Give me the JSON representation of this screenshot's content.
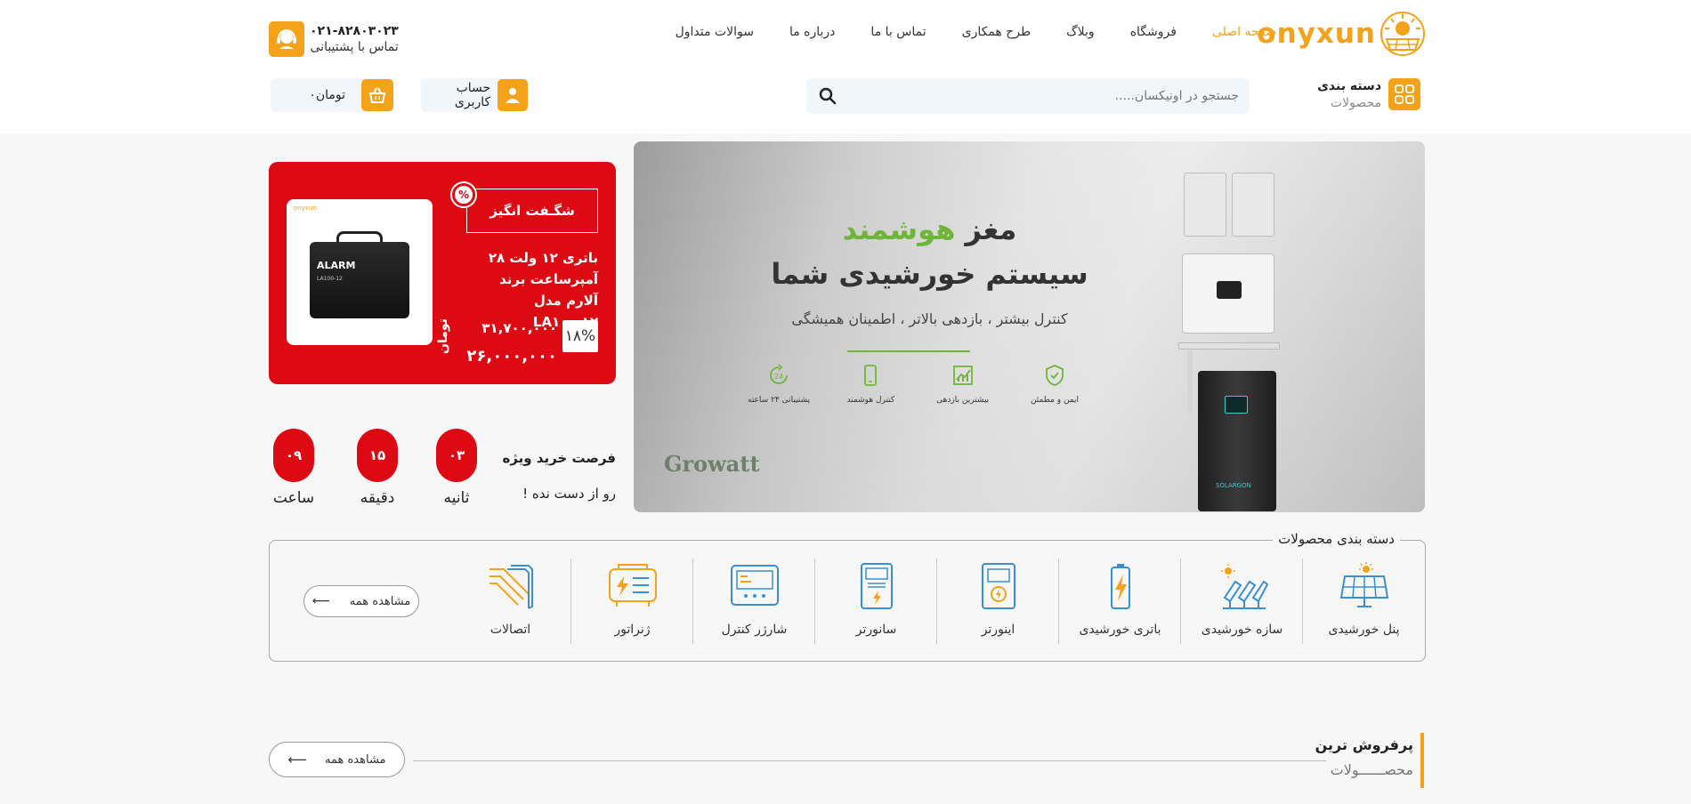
{
  "header": {
    "logo_text": "onyxun",
    "nav": [
      {
        "label": "صفحه اصلی",
        "active": true
      },
      {
        "label": "فروشگاه"
      },
      {
        "label": "وبلاگ"
      },
      {
        "label": "طرح همکاری"
      },
      {
        "label": "تماس با ما"
      },
      {
        "label": "درباره ما"
      },
      {
        "label": "سوالات متداول"
      }
    ],
    "support_phone": "۰۲۱-۸۲۸۰۳۰۲۳",
    "support_label": "تماس با پشتیبانی",
    "category_title": "دسته بندی",
    "category_sub": "محصولات",
    "search_placeholder": "جستجو در اونیکسان.....",
    "account_label": "حساب کاربری",
    "cart_label": "تومان۰"
  },
  "banner": {
    "headline_1": "مغز ",
    "headline_1_green": "هوشمند",
    "headline_2": "سیستم خورشیدی شما",
    "subtitle": "کنترل بیشتر ، بازدهی بالاتر ، اطمینان همیشگی",
    "features": [
      {
        "label": "پشتیبانی ۲۴ ساعته",
        "icon": "support-24h-icon"
      },
      {
        "label": "کنترل هوشمند",
        "icon": "smartphone-icon"
      },
      {
        "label": "بیشترین بازدهی",
        "icon": "chart-icon"
      },
      {
        "label": "ایمن و مطمئن",
        "icon": "shield-icon"
      }
    ],
    "brand": "Growatt",
    "battery_label": "SOLARGON"
  },
  "promo": {
    "badge": "شگـفت انگیز",
    "title": "باتری ۱۲ ولت ۲۸ آمپرساعت برند آلارم مدل LA۱۰۰-۱۲",
    "discount": "۱۸%",
    "old_price": "۳۱,۷۰۰,۰۰۰",
    "price": "۲۶,۰۰۰,۰۰۰",
    "currency": "تومان",
    "product_brand": "onyxun",
    "battery_text": "ALARM",
    "battery_model": "LA100-12"
  },
  "countdown": {
    "title": "فرصت خرید ویژه",
    "subtitle": "رو از دست نده !",
    "units": [
      {
        "value": "۰۳",
        "label": "ثانیه"
      },
      {
        "value": "۱۵",
        "label": "دقیقه"
      },
      {
        "value": "۰۹",
        "label": "ساعت"
      }
    ]
  },
  "categories": {
    "legend": "دسته بندی محصولات",
    "items": [
      {
        "label": "پنل خورشیدی",
        "icon": "solar-panel-icon"
      },
      {
        "label": "سازه خورشیدی",
        "icon": "solar-structure-icon"
      },
      {
        "label": "باتری خورشیدی",
        "icon": "battery-icon"
      },
      {
        "label": "اینورتر",
        "icon": "inverter-icon"
      },
      {
        "label": "سانورتر",
        "icon": "sunverter-icon"
      },
      {
        "label": "شارژر کنترل",
        "icon": "charge-controller-icon"
      },
      {
        "label": "ژنراتور",
        "icon": "generator-icon"
      },
      {
        "label": "اتصالات",
        "icon": "connectors-icon"
      }
    ],
    "see_all": "مشاهده همه"
  },
  "bestsellers": {
    "title": "پرفروش ترین",
    "subtitle": "محصــــــولات",
    "see_all": "مشاهده همه"
  },
  "colors": {
    "accent": "#f5a21b",
    "promo_red": "#dd0a14",
    "banner_green": "#6fb53a"
  }
}
